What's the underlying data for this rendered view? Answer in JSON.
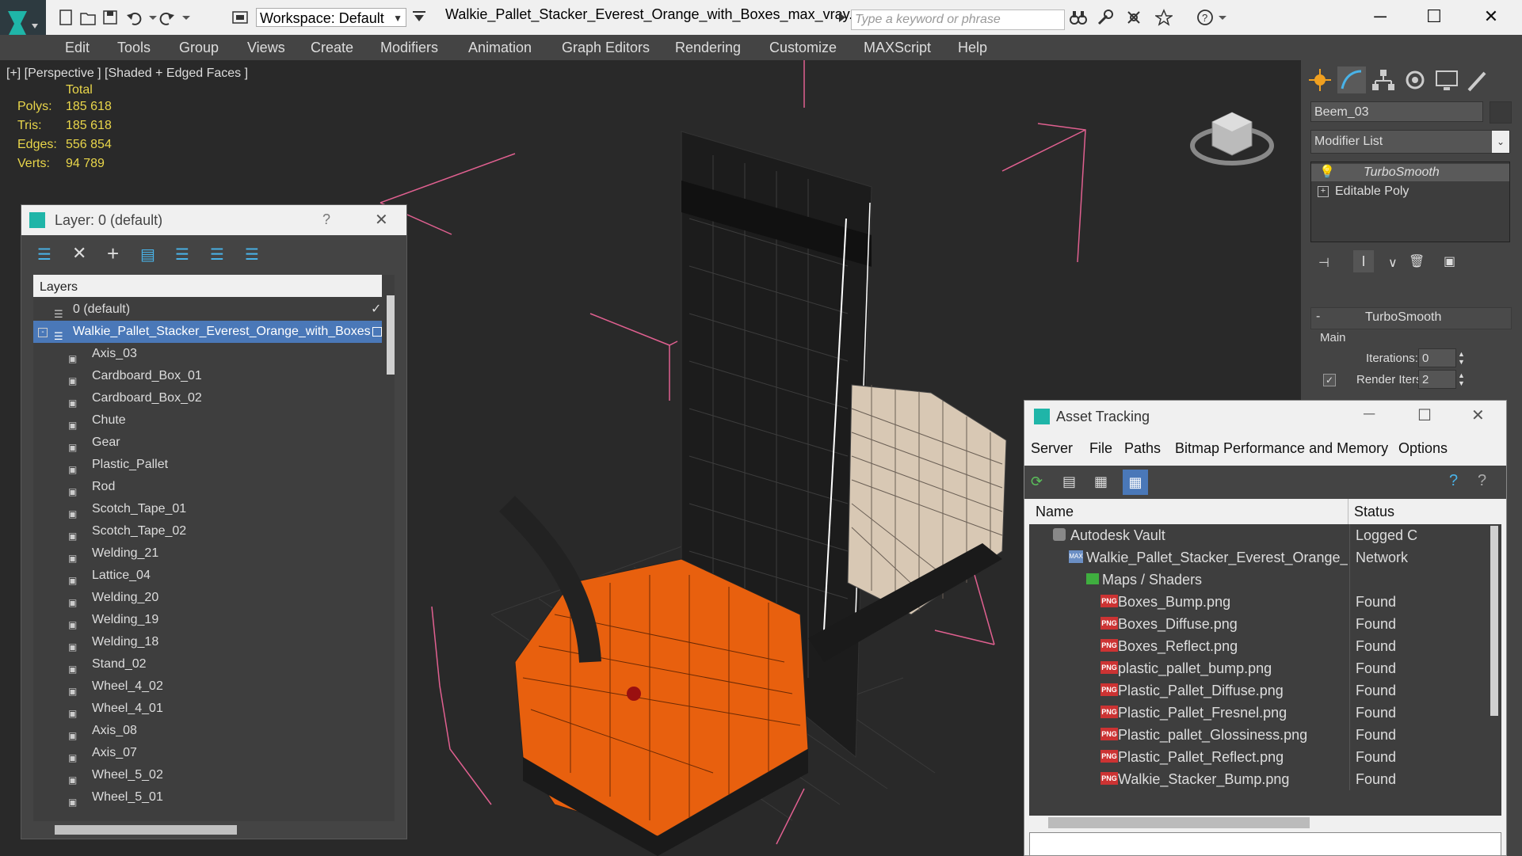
{
  "app": {
    "workspace": "Workspace: Default",
    "document_title": "Walkie_Pallet_Stacker_Everest_Orange_with_Boxes_max_vray...",
    "search_placeholder": "Type a keyword or phrase"
  },
  "menu": [
    "Edit",
    "Tools",
    "Group",
    "Views",
    "Create",
    "Modifiers",
    "Animation",
    "Graph Editors",
    "Rendering",
    "Customize",
    "MAXScript",
    "Help"
  ],
  "viewport": {
    "label": "[+] [Perspective ] [Shaded + Edged Faces ]",
    "stats": {
      "header": "Total",
      "rows": [
        {
          "label": "Polys:",
          "value": "185 618"
        },
        {
          "label": "Tris:",
          "value": "185 618"
        },
        {
          "label": "Edges:",
          "value": "556 854"
        },
        {
          "label": "Verts:",
          "value": "94 789"
        }
      ]
    }
  },
  "command_panel": {
    "object_name": "Beem_03",
    "modifier_list": "Modifier List",
    "stack": [
      "TurboSmooth",
      "Editable Poly"
    ],
    "rollout_title": "TurboSmooth",
    "group_main": "Main",
    "iterations_label": "Iterations:",
    "iterations_value": "0",
    "render_iters_label": "Render Iters:",
    "render_iters_value": "2"
  },
  "layer_explorer": {
    "title": "Layer: 0 (default)",
    "help": "?",
    "column_header": "Layers",
    "default_layer": "0 (default)",
    "selected_layer": "Walkie_Pallet_Stacker_Everest_Orange_with_Boxes",
    "objects": [
      "Axis_03",
      "Cardboard_Box_01",
      "Cardboard_Box_02",
      "Chute",
      "Gear",
      "Plastic_Pallet",
      "Rod",
      "Scotch_Tape_01",
      "Scotch_Tape_02",
      "Welding_21",
      "Lattice_04",
      "Welding_20",
      "Welding_19",
      "Welding_18",
      "Stand_02",
      "Wheel_4_02",
      "Wheel_4_01",
      "Axis_08",
      "Axis_07",
      "Wheel_5_02",
      "Wheel_5_01"
    ]
  },
  "asset_tracking": {
    "title": "Asset Tracking",
    "menu": [
      "Server",
      "File",
      "Paths",
      "Bitmap Performance and Memory",
      "Options"
    ],
    "columns": {
      "name": "Name",
      "status": "Status"
    },
    "vault": {
      "name": "Autodesk Vault",
      "status": "Logged C"
    },
    "file": {
      "name": "Walkie_Pallet_Stacker_Everest_Orange_with_Boxes_...",
      "status": "Network"
    },
    "maps_folder": "Maps / Shaders",
    "maps": [
      {
        "name": "Boxes_Bump.png",
        "status": "Found"
      },
      {
        "name": "Boxes_Diffuse.png",
        "status": "Found"
      },
      {
        "name": "Boxes_Reflect.png",
        "status": "Found"
      },
      {
        "name": "plastic_pallet_bump.png",
        "status": "Found"
      },
      {
        "name": "Plastic_Pallet_Diffuse.png",
        "status": "Found"
      },
      {
        "name": "Plastic_Pallet_Fresnel.png",
        "status": "Found"
      },
      {
        "name": "Plastic_pallet_Glossiness.png",
        "status": "Found"
      },
      {
        "name": "Plastic_Pallet_Reflect.png",
        "status": "Found"
      },
      {
        "name": "Walkie_Stacker_Bump.png",
        "status": "Found"
      }
    ]
  },
  "colors": {
    "selection": "#4a78b8",
    "stats_yellow": "#e9d64a",
    "forklift_orange": "#e8600e",
    "gizmo_pink": "#e06090"
  }
}
